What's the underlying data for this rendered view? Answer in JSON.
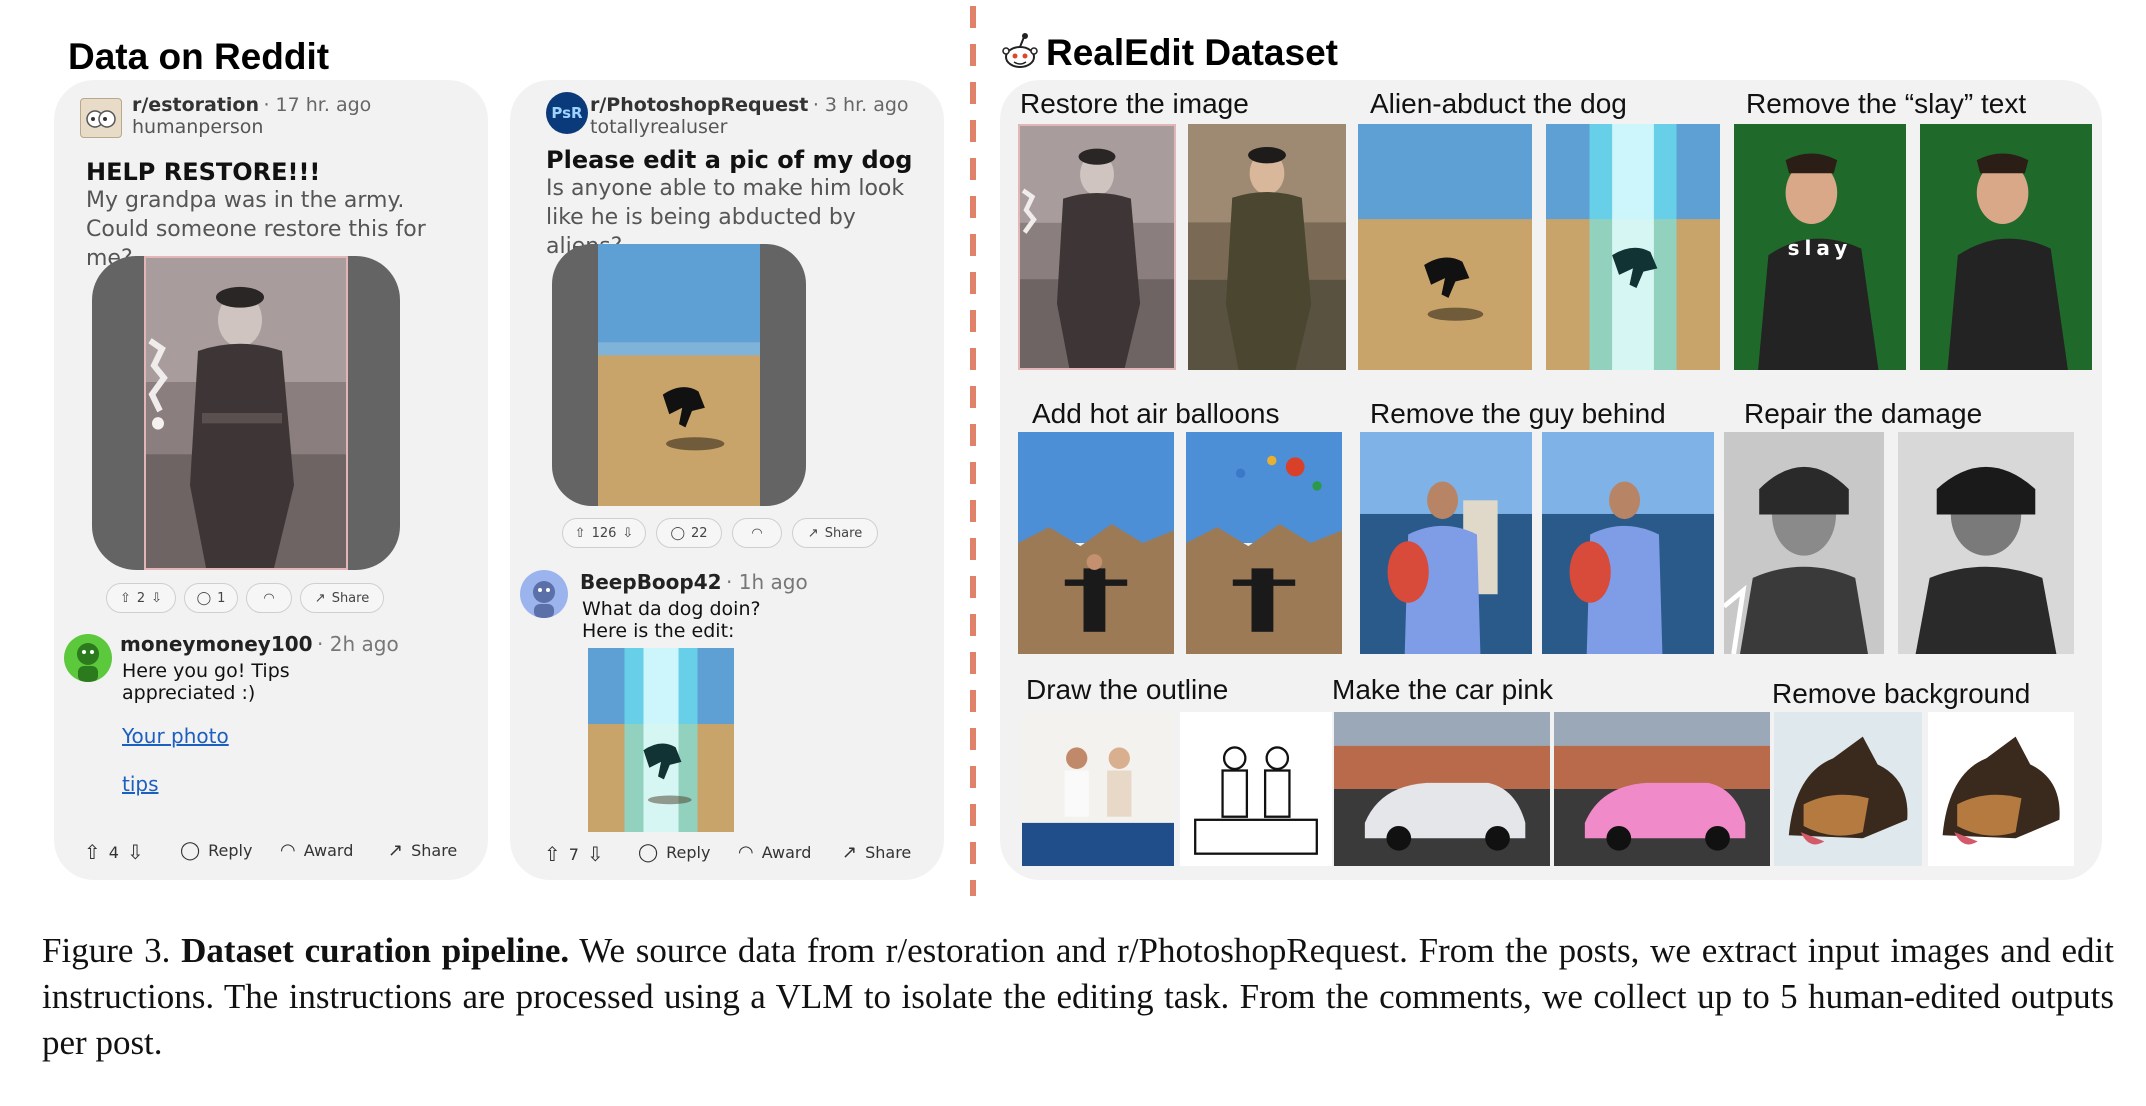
{
  "left_title": "Data on Reddit",
  "right_title": "RealEdit Dataset",
  "post1": {
    "subreddit": "r/estoration",
    "time": "· 17 hr. ago",
    "user": "humanperson",
    "title": "HELP RESTORE!!!",
    "body": "My grandpa was in the army. Could someone restore this for me?",
    "votes": "2",
    "comments": "1",
    "share": "Share",
    "comment": {
      "user": "moneymoney100",
      "time": "· 2h ago",
      "text": "Here you go! Tips appreciated :)",
      "link1": "Your photo",
      "link2": "tips"
    },
    "actions": {
      "votes": "4",
      "reply": "Reply",
      "award": "Award",
      "share": "Share"
    }
  },
  "post2": {
    "subreddit": "r/PhotoshopRequest",
    "time": "· 3 hr. ago",
    "user": "totallyrealuser",
    "avatar_text": "PsR",
    "title": "Please edit a pic of my dog",
    "body": "Is anyone able to make him look like he is being abducted by aliens?",
    "votes": "126",
    "comments": "22",
    "share": "Share",
    "comment": {
      "user": "BeepBoop42",
      "time": "· 1h ago",
      "line1": "What da dog doin?",
      "line2": "Here is the edit:"
    },
    "actions": {
      "votes": "7",
      "reply": "Reply",
      "award": "Award",
      "share": "Share"
    }
  },
  "tasks": [
    "Restore the image",
    "Alien-abduct the dog",
    "Remove the “slay” text",
    "Add hot air balloons",
    "Remove the guy behind",
    "Repair the damage",
    "Draw the outline",
    "Make the car pink",
    "Remove background"
  ],
  "slay_text": "slay",
  "caption": {
    "label": "Figure 3.",
    "bold": "Dataset curation pipeline.",
    "text": "We source data from r/estoration and r/PhotoshopRequest. From the posts, we extract input images and edit instructions.  The instructions are processed using a VLM to isolate the editing task.  From the comments, we collect up to 5 human-edited outputs per post."
  },
  "colors": {
    "divider": "#e0826a",
    "card": "#f2f2f2",
    "frame": "#646464",
    "link": "#1d5fbf"
  }
}
